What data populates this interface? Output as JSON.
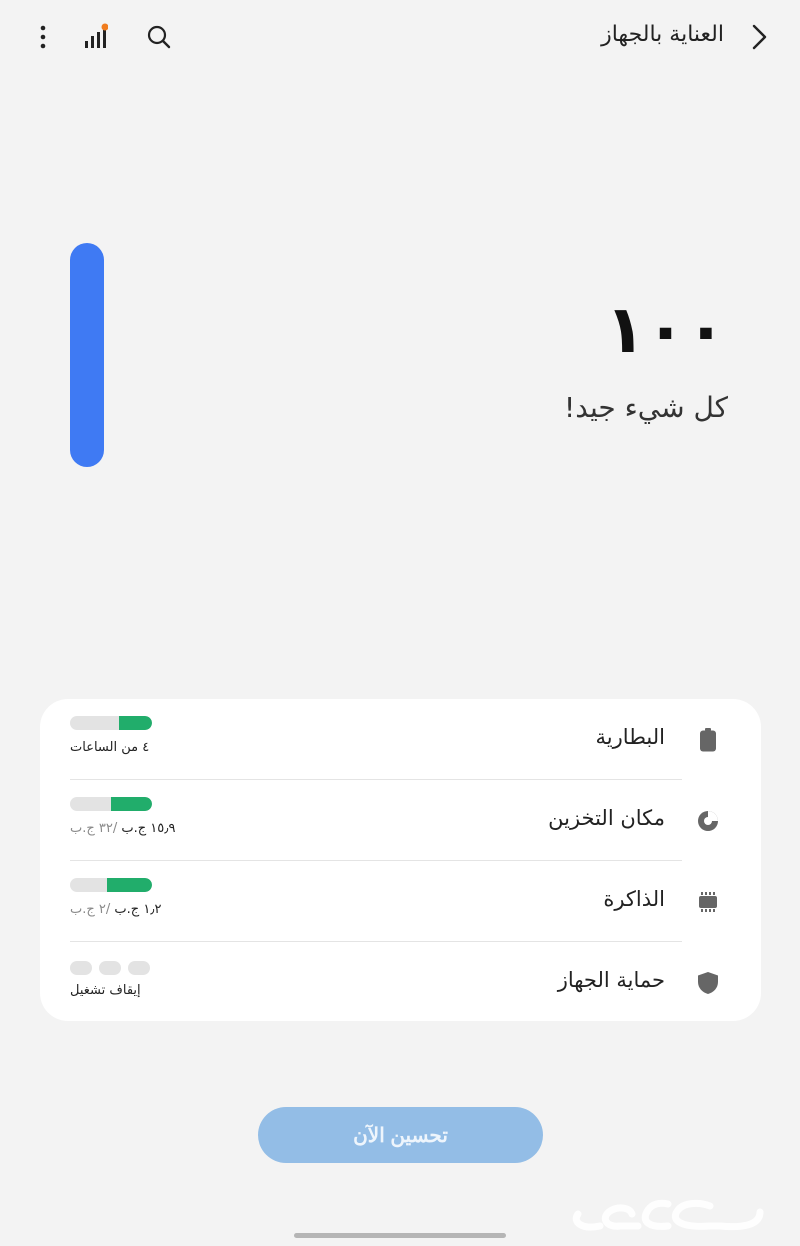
{
  "header": {
    "title": "العناية بالجهاز",
    "back_icon": "chevron-right-icon",
    "search_icon": "search-icon",
    "stats_icon": "signal-bars-icon",
    "more_icon": "more-vertical-icon",
    "notification_dot_color": "#f07c1e"
  },
  "summary": {
    "score": "١٠٠",
    "score_value": 100,
    "status": "كل شيء جيد!",
    "bar_color": "#3f7af3"
  },
  "items": [
    {
      "label": "البطارية",
      "icon": "battery-icon",
      "value": "٤ من الساعات",
      "value_muted": "",
      "level": 0.4,
      "fill_color": "#21ad6b"
    },
    {
      "label": "مكان التخزين",
      "icon": "storage-pie-icon",
      "value": "١٥٫٩ ج.ب",
      "value_muted": " /٣٢ ج.ب",
      "level": 0.5,
      "fill_color": "#21ad6b"
    },
    {
      "label": "الذاكرة",
      "icon": "memory-chip-icon",
      "value": "١٫٢ ج.ب",
      "value_muted": " /٢ ج.ب",
      "level": 0.55,
      "fill_color": "#21ad6b"
    },
    {
      "label": "حماية الجهاز",
      "icon": "shield-icon",
      "value": "إيقاف تشغيل",
      "value_muted": ""
    }
  ],
  "actions": {
    "optimize_label": "تحسين الآن",
    "optimize_color": "#93bde6"
  },
  "watermark": "حراج"
}
